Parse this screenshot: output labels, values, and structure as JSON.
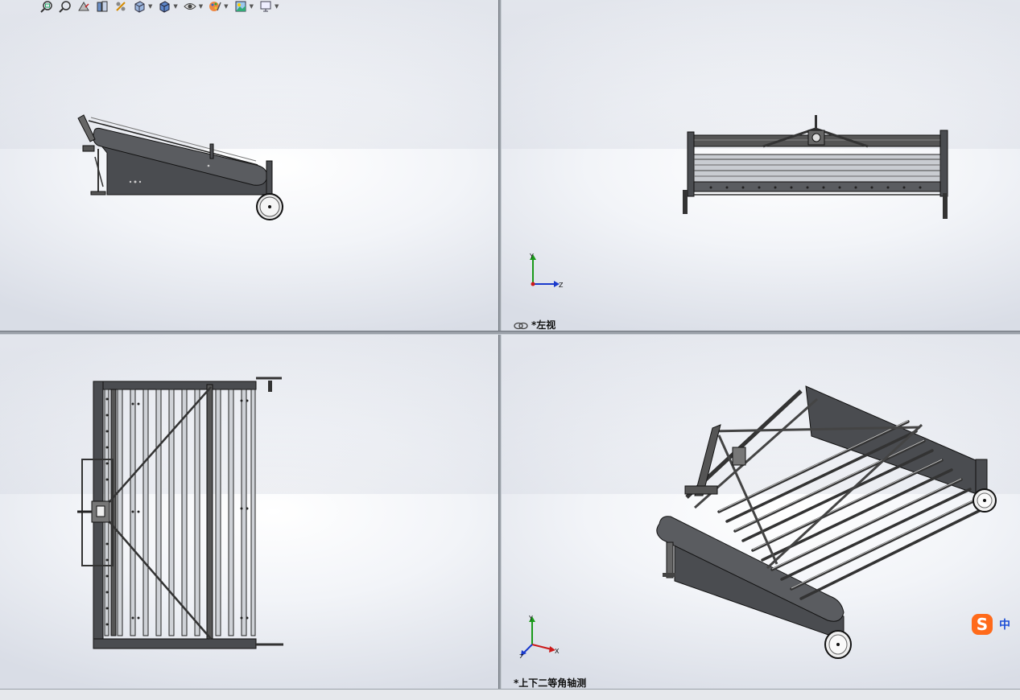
{
  "toolbar": {
    "items": [
      {
        "icon": "zoom-to-fit-icon"
      },
      {
        "icon": "zoom-to-area-icon"
      },
      {
        "icon": "previous-view-icon"
      },
      {
        "icon": "section-view-icon"
      },
      {
        "icon": "dynamic-annotation-icon"
      },
      {
        "icon": "view-orientation-icon"
      },
      {
        "icon": "display-style-icon"
      },
      {
        "icon": "hide-show-items-icon"
      },
      {
        "icon": "edit-appearance-icon"
      },
      {
        "icon": "apply-scene-icon"
      },
      {
        "icon": "view-settings-icon"
      }
    ]
  },
  "viewports": {
    "top_left": {
      "label": ""
    },
    "top_right": {
      "label": "*左视"
    },
    "bottom_left": {
      "label": ""
    },
    "bottom_right": {
      "label": "*上下二等角轴测"
    }
  },
  "triad": {
    "y": "Y",
    "z": "Z",
    "x": "X"
  },
  "ime": {
    "logo": "S",
    "mode": "中"
  },
  "colors": {
    "metal": "#4a4c50",
    "metal_light": "#8a8d92",
    "outline": "#1a1a1a",
    "ime_orange": "#ff6a1a",
    "ime_blue": "#1d4fd6"
  }
}
